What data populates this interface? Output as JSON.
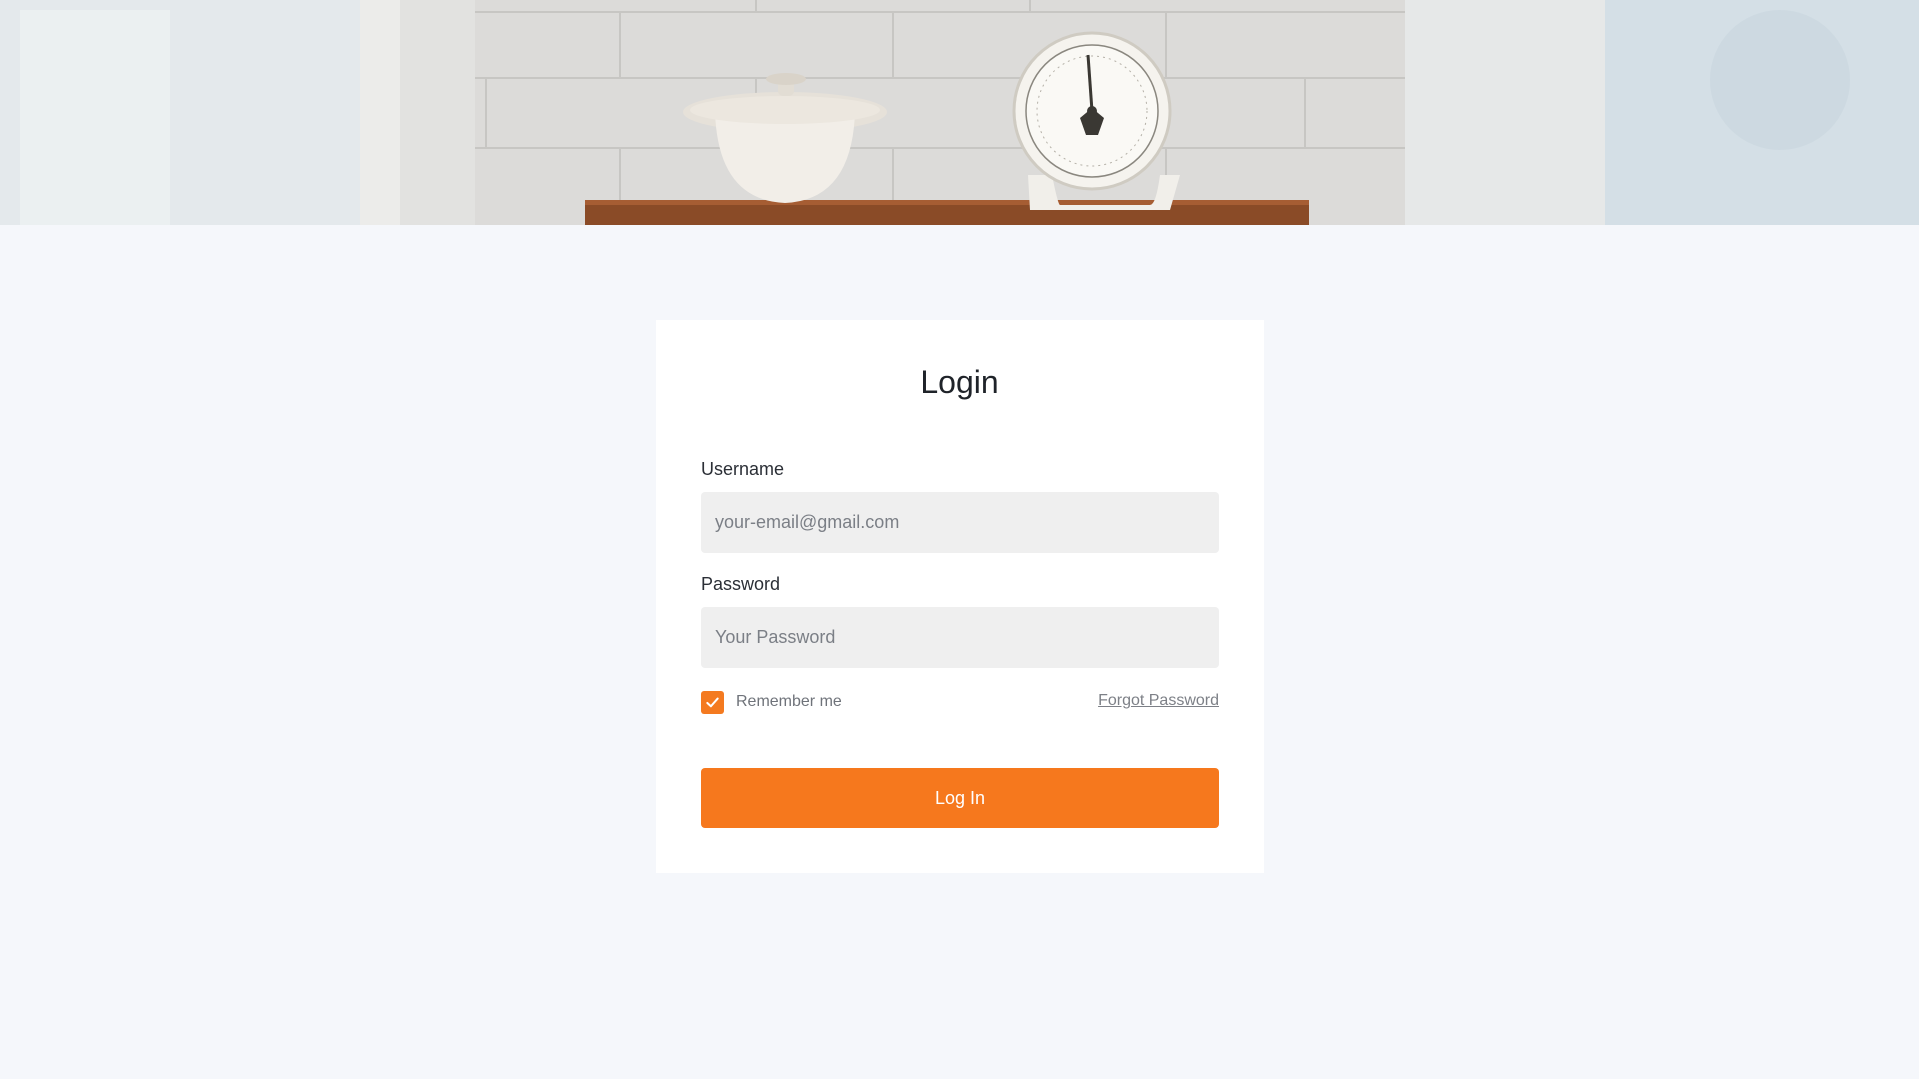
{
  "login": {
    "title": "Login",
    "username_label": "Username",
    "username_placeholder": "your-email@gmail.com",
    "password_label": "Password",
    "password_placeholder": "Your Password",
    "remember_label": "Remember me",
    "remember_checked": true,
    "forgot_label": "Forgot Password",
    "submit_label": "Log In"
  },
  "colors": {
    "accent": "#f6781d",
    "page_background": "#f5f7fb",
    "card_background": "#ffffff",
    "input_background": "#efefef"
  },
  "icons": {
    "checkbox": "check-icon"
  }
}
